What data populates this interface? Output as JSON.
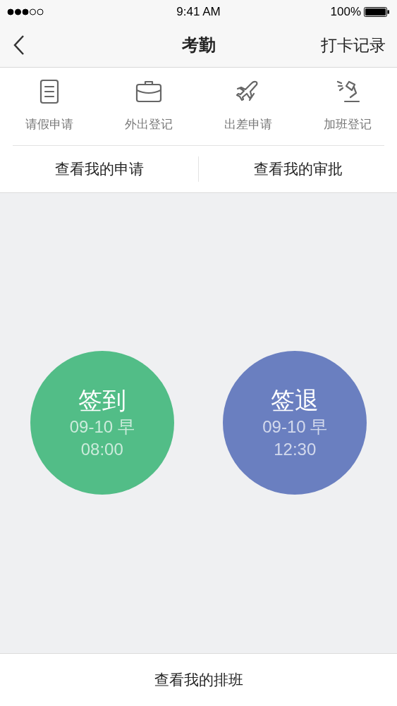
{
  "status_bar": {
    "time": "9:41 AM",
    "battery": "100%"
  },
  "nav": {
    "title": "考勤",
    "action": "打卡记录"
  },
  "shortcuts": [
    {
      "label": "请假申请"
    },
    {
      "label": "外出登记"
    },
    {
      "label": "出差申请"
    },
    {
      "label": "加班登记"
    }
  ],
  "links": [
    "查看我的申请",
    "查看我的审批"
  ],
  "punch_buttons": [
    {
      "title": "签到",
      "date": "09-10 早",
      "time": "08:00",
      "color": "#52bd87"
    },
    {
      "title": "签退",
      "date": "09-10 早",
      "time": "12:30",
      "color": "#6a7fc0"
    }
  ],
  "bottom_link": "查看我的排班"
}
